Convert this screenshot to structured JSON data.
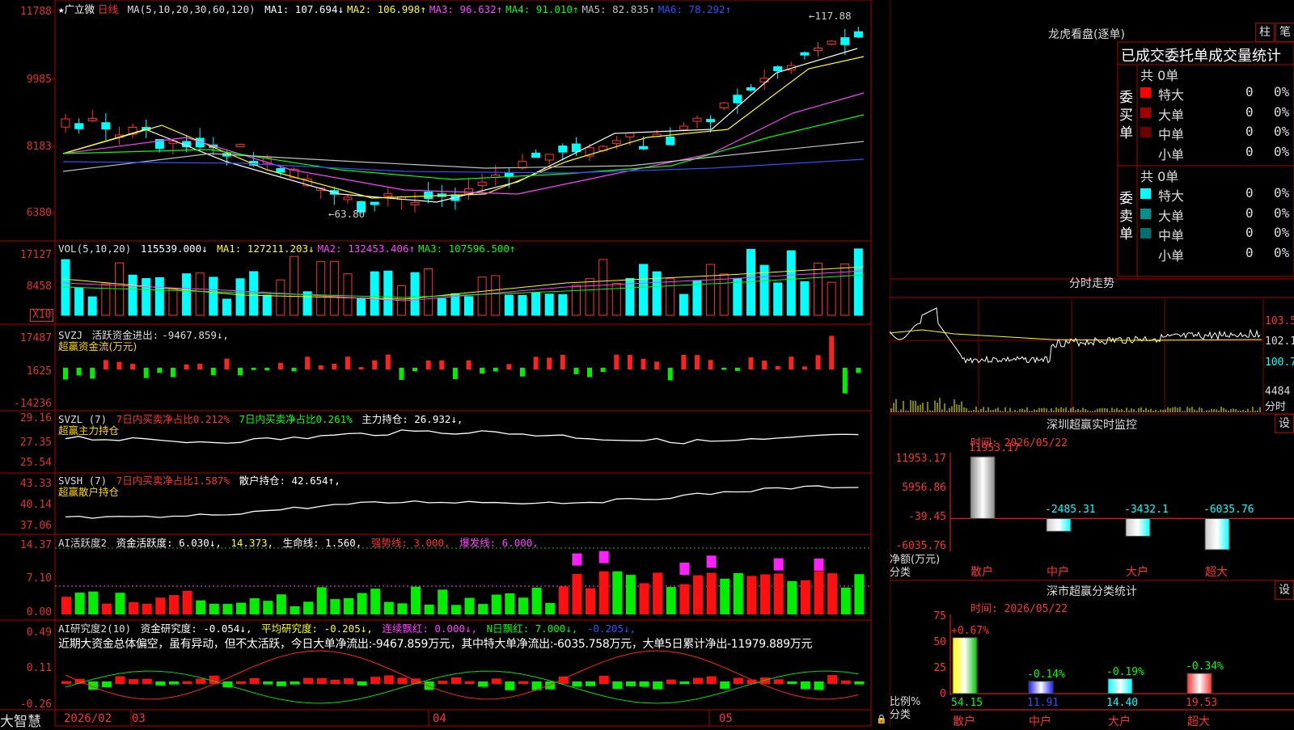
{
  "app": {
    "brand": "大智慧"
  },
  "stock": {
    "star": "★",
    "name": "广立微",
    "period": "日线"
  },
  "ma_line": {
    "label": "MA(5,10,20,30,60,120)",
    "items": [
      {
        "k": "MA1:",
        "v": "107.694↓",
        "color": "#ffffff"
      },
      {
        "k": "MA2:",
        "v": "106.998↑",
        "color": "#ffff00"
      },
      {
        "k": "MA3:",
        "v": "96.632↑",
        "color": "#ff40ff"
      },
      {
        "k": "MA4:",
        "v": "91.010↑",
        "color": "#00ff00"
      },
      {
        "k": "MA5:",
        "v": "82.835↑",
        "color": "#c0c0c0"
      },
      {
        "k": "MA6:",
        "v": "78.292↑",
        "color": "#3050ff"
      }
    ]
  },
  "price_axis": [
    "11788",
    "9985",
    "8183",
    "6380"
  ],
  "price_marks": {
    "high": "117.88",
    "low": "63.80"
  },
  "vol_header": {
    "label": "VOL(5,10,20)",
    "value": "115539.000↓",
    "items": [
      {
        "k": "MA1:",
        "v": "127211.203↓",
        "color": "#ffff00"
      },
      {
        "k": "MA2:",
        "v": "132453.406↑",
        "color": "#ff40ff"
      },
      {
        "k": "MA3:",
        "v": "107596.500↑",
        "color": "#00ff00"
      }
    ]
  },
  "vol_axis": [
    "17127",
    "8458"
  ],
  "vol_unit": "X10",
  "svzj": {
    "label": "SVZJ",
    "text": "活跃资金进出:",
    "value": "-9467.859↓,",
    "sub": "超赢资金流(万元)"
  },
  "svzj_axis": [
    "17487",
    "1625",
    "-14236"
  ],
  "svzl": {
    "label": "SVZL (7)",
    "t1": "7日内买卖净占比0.212%",
    "t2": "7日内买卖净占比0.261%",
    "t3": "主力持仓: 26.932↓,",
    "sub": "超赢主力持仓"
  },
  "svzl_axis": [
    "29.16",
    "27.35",
    "25.54"
  ],
  "svsh": {
    "label": "SVSH (7)",
    "t1": "7日内买卖净占比1.587%",
    "t2": "散户持仓: 42.654↑,",
    "sub": "超赢散户持仓"
  },
  "svsh_axis": [
    "43.33",
    "40.14",
    "37.06"
  ],
  "ai_act": {
    "label": "AI活跃度2",
    "t1": "资金活跃度: 6.030↓,",
    "t2": "14.373,",
    "t3": "生命线: 1.560,",
    "t4": "强势线: 3.000,",
    "t5": "爆发线: 6.000,"
  },
  "ai_act_axis": [
    "14.37",
    "7.10",
    "0.00"
  ],
  "ai_res": {
    "label": "AI研究度2(10)",
    "t1": "资金研究度: -0.054↓,",
    "t2": "平均研究度: -0.205↓,",
    "t3": "连续飘红: 0.000↓,",
    "t4": "N日飘红: 7.000↓,",
    "t5": "-0.205↓,",
    "comment": "近期大资金总体偏空，虽有异动，但不太活跃，今日大单净流出:-9467.859万元，其中特大单净流出:-6035.758万元，大单5日累计净出-11979.889万元"
  },
  "ai_res_axis": [
    "0.49",
    "0.11",
    "-0.26"
  ],
  "date_axis": [
    "2026/02",
    "03",
    "04",
    "05"
  ],
  "dragon": {
    "title": "龙虎看盘(逐单)",
    "btn1": "柱",
    "btn2": "笔",
    "subtitle": "已成交委托单成交量统计",
    "buy_label": "委买单",
    "sell_label": "委卖单",
    "buy_total": "共 0单",
    "sell_total": "共 0单",
    "buy_rows": [
      {
        "name": "特大",
        "count": "0",
        "pct": "0%",
        "color": "#ff0000"
      },
      {
        "name": "大单",
        "count": "0",
        "pct": "0%",
        "color": "#a00000"
      },
      {
        "name": "中单",
        "count": "0",
        "pct": "0%",
        "color": "#700000"
      },
      {
        "name": "小单",
        "count": "0",
        "pct": "0%",
        "color": ""
      }
    ],
    "sell_rows": [
      {
        "name": "特大",
        "count": "0",
        "pct": "0%",
        "color": "#00ffff"
      },
      {
        "name": "大单",
        "count": "0",
        "pct": "0%",
        "color": "#009090"
      },
      {
        "name": "中单",
        "count": "0",
        "pct": "0%",
        "color": "#006f6f"
      },
      {
        "name": "小单",
        "count": "0",
        "pct": "0%",
        "color": ""
      }
    ]
  },
  "intraday": {
    "title": "分时走势",
    "axis": [
      "103.5",
      "102.1",
      "100.7"
    ],
    "vol": "4484",
    "unit": "分时"
  },
  "sz_monitor": {
    "title": "深圳超赢实时监控",
    "btn": "设",
    "time": "时间: 2026/05/22",
    "axis": [
      "11953.17",
      "5956.86",
      "-39.45",
      "-6035.76"
    ],
    "ylabel": "净额(万元)",
    "xlabel": "分类"
  },
  "sz_class": {
    "title": "深市超赢分类统计",
    "btn": "设",
    "time": "时间: 2026/05/22",
    "axis": [
      "75",
      "50",
      "25",
      "0"
    ],
    "ylabel": "比例%",
    "xlabel": "分类"
  },
  "chart_data": [
    {
      "type": "bar",
      "title": "深圳超赢实时监控",
      "categories": [
        "散户",
        "中户",
        "大户",
        "超大"
      ],
      "values": [
        11953.17,
        -2485.31,
        -3432.1,
        -6035.76
      ],
      "value_labels": [
        "11953.17",
        "-2485.31",
        "-3432.1",
        "-6035.76"
      ],
      "ylim": [
        -6035.76,
        11953.17
      ],
      "ylabel": "净额(万元)",
      "xlabel": "分类"
    },
    {
      "type": "bar",
      "title": "深市超赢分类统计",
      "categories": [
        "散户",
        "中户",
        "大户",
        "超大"
      ],
      "values": [
        54.15,
        11.91,
        14.4,
        19.53
      ],
      "value_labels": [
        "54.15",
        "11.91",
        "14.40",
        "19.53"
      ],
      "change_labels": [
        "+0.67%",
        "-0.14%",
        "-0.19%",
        "-0.34%"
      ],
      "ylim": [
        0,
        75
      ],
      "ylabel": "比例%",
      "xlabel": "分类"
    }
  ]
}
